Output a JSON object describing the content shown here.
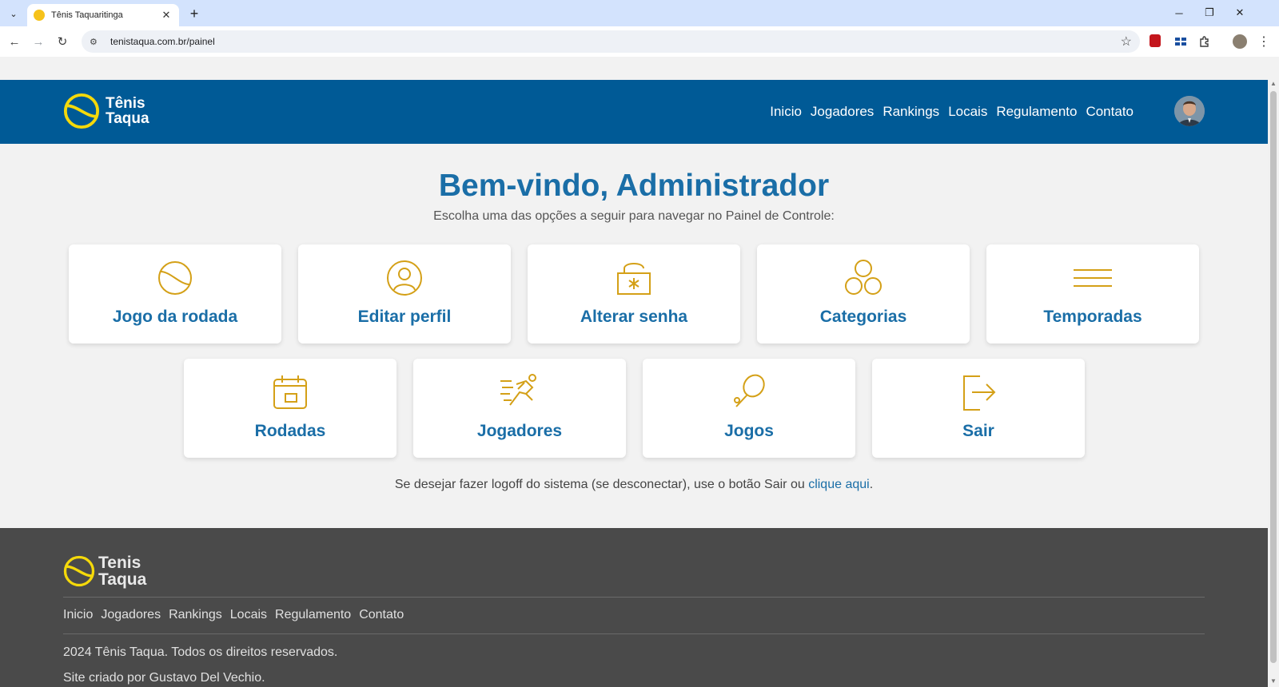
{
  "browser": {
    "tab_title": "Tênis Taquaritinga",
    "url": "tenistaqua.com.br/painel",
    "tab_close": "✕",
    "new_tab": "+",
    "tab_list": "⌄",
    "back": "←",
    "forward": "→",
    "reload": "↻",
    "minimize": "─",
    "restore": "❐",
    "close": "✕",
    "star": "☆",
    "site_info": "⚙",
    "menu": "⋮"
  },
  "header": {
    "logo_line1": "Tênis",
    "logo_line2": "Taqua",
    "nav": [
      "Inicio",
      "Jogadores",
      "Rankings",
      "Locais",
      "Regulamento",
      "Contato"
    ]
  },
  "main": {
    "title": "Bem-vindo, Administrador",
    "subtitle": "Escolha uma das opções a seguir para navegar no Painel de Controle:",
    "cards_row1": [
      {
        "label": "Jogo da rodada",
        "icon": "tennis-ball-icon"
      },
      {
        "label": "Editar perfil",
        "icon": "user-icon"
      },
      {
        "label": "Alterar senha",
        "icon": "lock-icon"
      },
      {
        "label": "Categorias",
        "icon": "circles-icon"
      },
      {
        "label": "Temporadas",
        "icon": "lines-icon"
      }
    ],
    "cards_row2": [
      {
        "label": "Rodadas",
        "icon": "calendar-icon"
      },
      {
        "label": "Jogadores",
        "icon": "runner-icon"
      },
      {
        "label": "Jogos",
        "icon": "racket-icon"
      },
      {
        "label": "Sair",
        "icon": "logout-icon"
      }
    ],
    "logoff_text": "Se desejar fazer logoff do sistema (se desconectar), use o botão Sair ou ",
    "logoff_link": "clique aqui",
    "logoff_end": "."
  },
  "footer": {
    "logo_line1": "Tenis",
    "logo_line2": "Taqua",
    "nav": [
      "Inicio",
      "Jogadores",
      "Rankings",
      "Locais",
      "Regulamento",
      "Contato"
    ],
    "copyright": "2024 Tênis Taqua. Todos os direitos reservados.",
    "credit": "Site criado por Gustavo Del Vechio."
  },
  "colors": {
    "header_bg": "#005a96",
    "accent": "#1a6ea7",
    "icon_gold": "#d4a017",
    "logo_yellow": "#f5d90a",
    "footer_bg": "#4a4a4a"
  }
}
